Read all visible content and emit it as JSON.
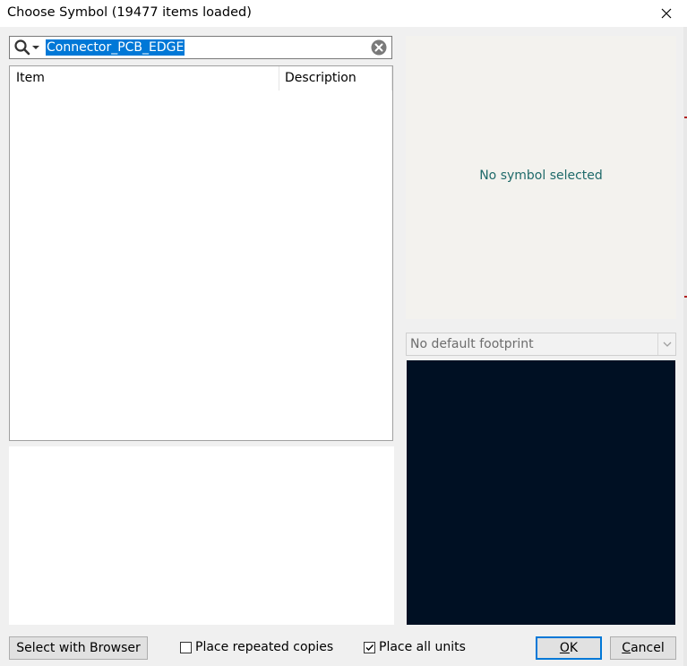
{
  "window": {
    "title": "Choose Symbol (19477 items loaded)"
  },
  "search": {
    "value": "Connector_PCB_EDGE"
  },
  "list": {
    "columns": [
      "Item",
      "Description"
    ],
    "rows": []
  },
  "preview": {
    "no_symbol_text": "No symbol selected"
  },
  "footprint": {
    "selected": "No default footprint"
  },
  "footer": {
    "browser_button": "Select with Browser",
    "repeat_label": "Place repeated copies",
    "repeat_checked": false,
    "units_label": "Place all units",
    "units_checked": true,
    "ok_underline": "O",
    "ok_rest": "K",
    "cancel_underline": "C",
    "cancel_rest": "ancel"
  },
  "colors": {
    "selection": "#0078d7",
    "preview_bg": "#f3f2ee",
    "footprint_bg": "#001023",
    "status_text": "#1f6a6a"
  }
}
